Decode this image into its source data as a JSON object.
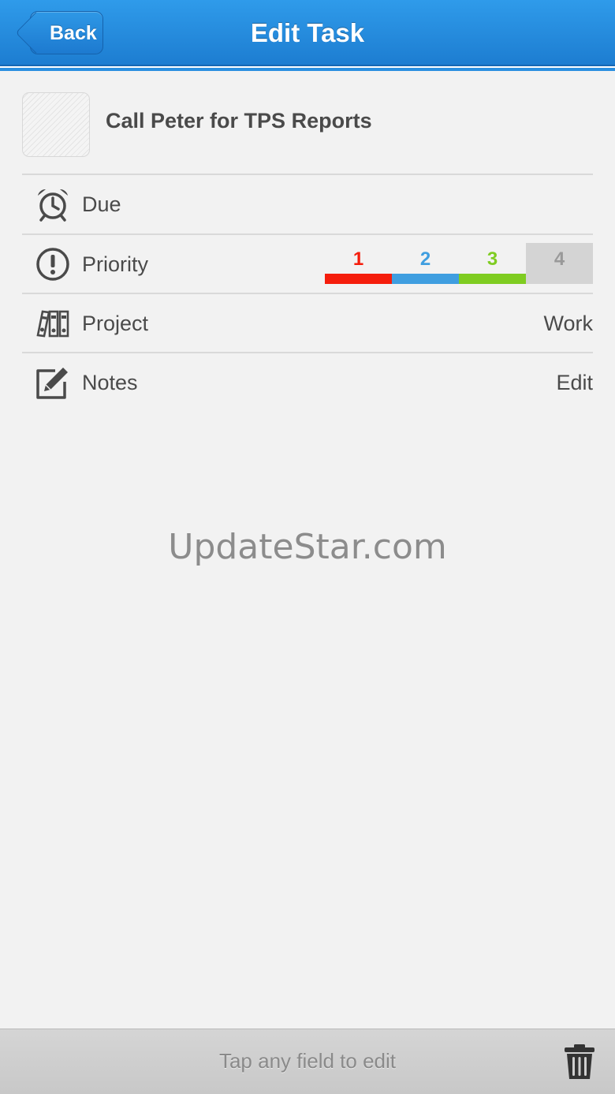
{
  "header": {
    "back_label": "Back",
    "title": "Edit Task"
  },
  "task": {
    "title": "Call Peter for TPS Reports"
  },
  "rows": {
    "due": {
      "label": "Due",
      "icon": "alarm-clock-icon"
    },
    "priority": {
      "label": "Priority",
      "icon": "exclamation-circle-icon",
      "selected": "4",
      "options": [
        {
          "label": "1",
          "color": "#f51d0c"
        },
        {
          "label": "2",
          "color": "#3f9ee0"
        },
        {
          "label": "3",
          "color": "#7fcc21"
        },
        {
          "label": "4",
          "color": "#999999"
        }
      ]
    },
    "project": {
      "label": "Project",
      "value": "Work",
      "icon": "binders-icon"
    },
    "notes": {
      "label": "Notes",
      "value": "Edit",
      "icon": "pencil-square-icon"
    }
  },
  "watermark": "UpdateStar.com",
  "footer": {
    "hint": "Tap any field to edit",
    "trash_icon": "trash-icon"
  }
}
